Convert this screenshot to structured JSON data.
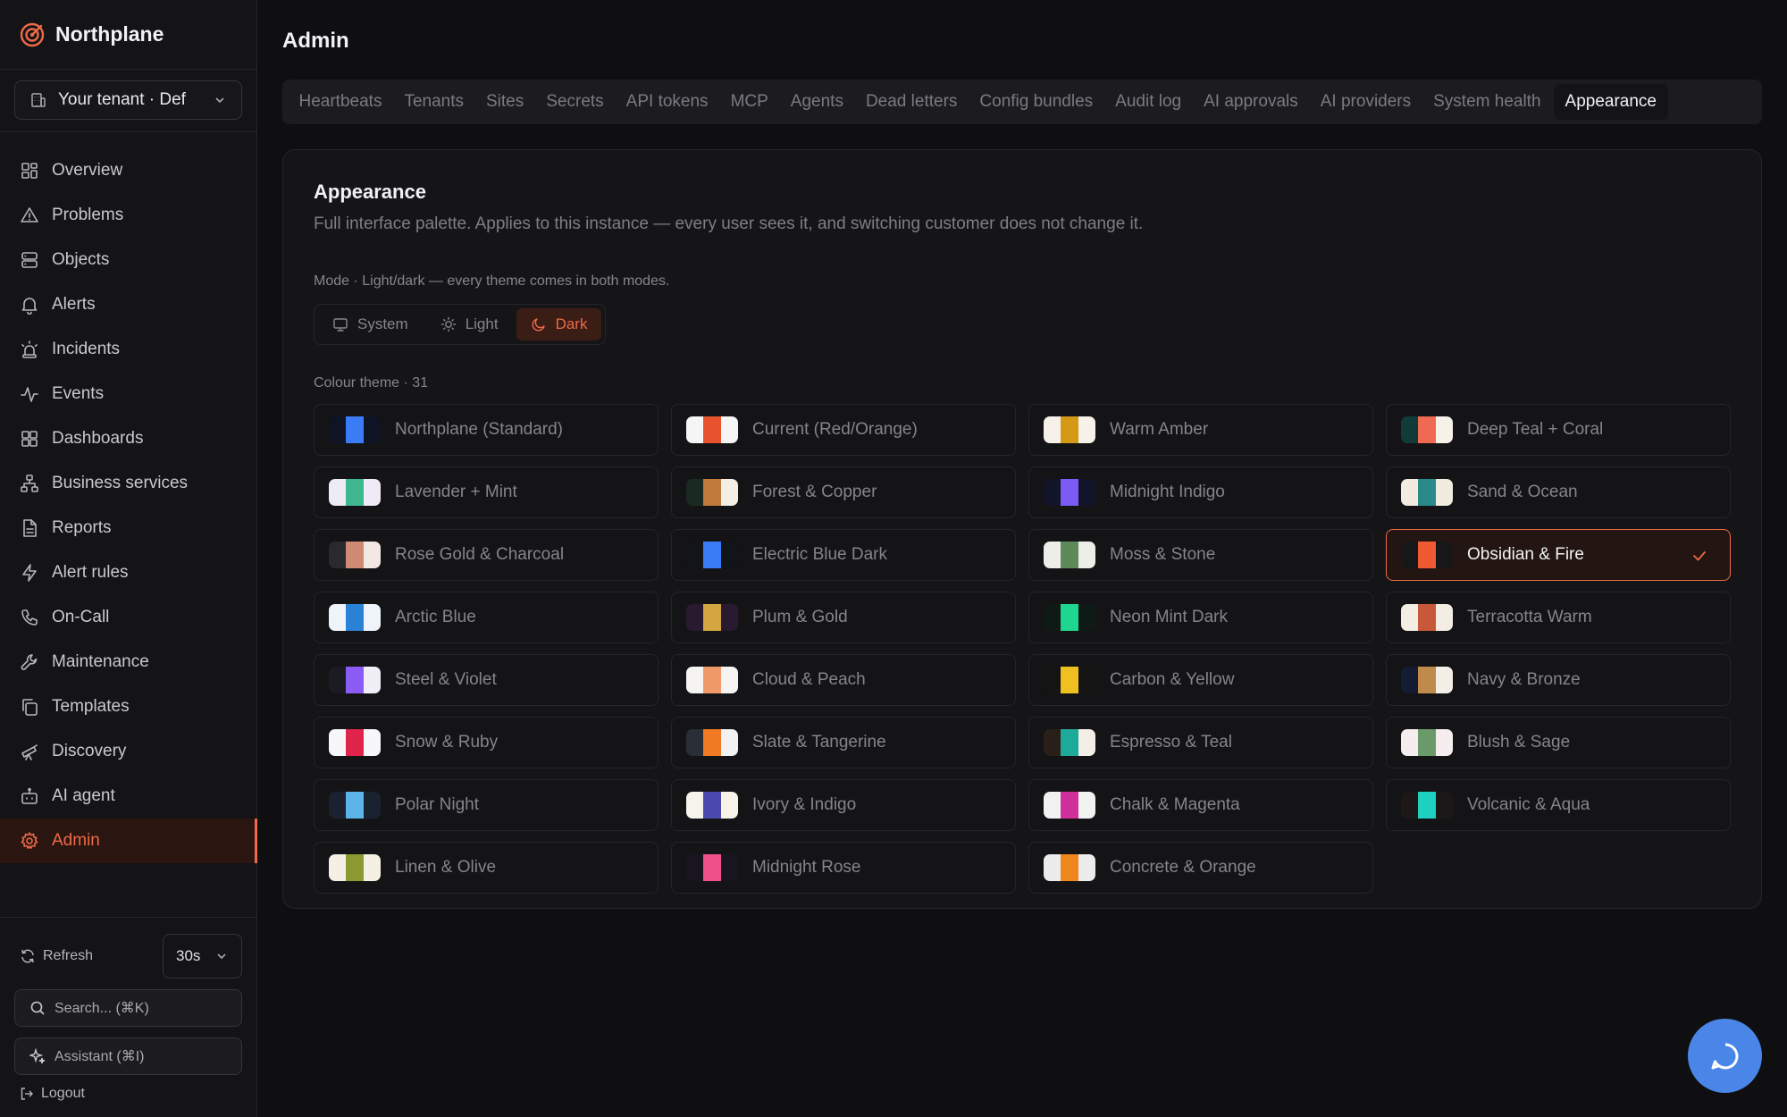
{
  "brand": {
    "name": "Northplane"
  },
  "tenant": {
    "label": "Your tenant · Def"
  },
  "nav": [
    {
      "label": "Overview",
      "icon": "grid-icon"
    },
    {
      "label": "Problems",
      "icon": "warning-icon"
    },
    {
      "label": "Objects",
      "icon": "server-icon"
    },
    {
      "label": "Alerts",
      "icon": "bell-icon"
    },
    {
      "label": "Incidents",
      "icon": "siren-icon"
    },
    {
      "label": "Events",
      "icon": "activity-icon"
    },
    {
      "label": "Dashboards",
      "icon": "dashboard-icon"
    },
    {
      "label": "Business services",
      "icon": "network-icon"
    },
    {
      "label": "Reports",
      "icon": "report-icon"
    },
    {
      "label": "Alert rules",
      "icon": "bolt-icon"
    },
    {
      "label": "On-Call",
      "icon": "phone-icon"
    },
    {
      "label": "Maintenance",
      "icon": "wrench-icon"
    },
    {
      "label": "Templates",
      "icon": "copy-icon"
    },
    {
      "label": "Discovery",
      "icon": "telescope-icon"
    },
    {
      "label": "AI agent",
      "icon": "bot-icon"
    },
    {
      "label": "Admin",
      "icon": "gear-icon",
      "active": true
    }
  ],
  "sidebar_bottom": {
    "refresh_label": "Refresh",
    "interval": "30s",
    "search_label": "Search... (⌘K)",
    "assistant_label": "Assistant (⌘I)",
    "logout_label": "Logout"
  },
  "page": {
    "title": "Admin"
  },
  "tabs": [
    "Heartbeats",
    "Tenants",
    "Sites",
    "Secrets",
    "API tokens",
    "MCP",
    "Agents",
    "Dead letters",
    "Config bundles",
    "Audit log",
    "AI approvals",
    "AI providers",
    "System health",
    "Appearance"
  ],
  "active_tab": "Appearance",
  "appearance": {
    "title": "Appearance",
    "description": "Full interface palette. Applies to this instance — every user sees it, and switching customer does not change it.",
    "mode_label": "Mode · Light/dark — every theme comes in both modes.",
    "modes": [
      {
        "label": "System",
        "icon": "monitor-icon"
      },
      {
        "label": "Light",
        "icon": "sun-icon"
      },
      {
        "label": "Dark",
        "icon": "moon-icon",
        "active": true
      }
    ],
    "theme_label": "Colour theme · 31",
    "accent_color": "#ee6a48"
  },
  "themes": [
    {
      "name": "Northplane (Standard)",
      "colors": [
        "#0e1424",
        "#3b7bf5",
        "#0e1424"
      ]
    },
    {
      "name": "Current (Red/Orange)",
      "colors": [
        "#f5f5f5",
        "#e8532e",
        "#f5f5f5"
      ]
    },
    {
      "name": "Warm Amber",
      "colors": [
        "#f6f2ea",
        "#d49a16",
        "#f6f2ea"
      ]
    },
    {
      "name": "Deep Teal + Coral",
      "colors": [
        "#123a38",
        "#f06a52",
        "#f6f2ea"
      ]
    },
    {
      "name": "Lavender + Mint",
      "colors": [
        "#eeeaf6",
        "#3fb890",
        "#eeeaf6"
      ]
    },
    {
      "name": "Forest & Copper",
      "colors": [
        "#1a2a20",
        "#c27a3c",
        "#f3efe6"
      ]
    },
    {
      "name": "Midnight Indigo",
      "colors": [
        "#12142a",
        "#7a5cf5",
        "#12142a"
      ]
    },
    {
      "name": "Sand & Ocean",
      "colors": [
        "#f2ece0",
        "#2a8a8a",
        "#f2ece0"
      ]
    },
    {
      "name": "Rose Gold & Charcoal",
      "colors": [
        "#2a2a2e",
        "#d08a74",
        "#f3e8e4"
      ]
    },
    {
      "name": "Electric Blue Dark",
      "colors": [
        "#111418",
        "#3a7cf5",
        "#111418"
      ]
    },
    {
      "name": "Moss & Stone",
      "colors": [
        "#eeeee8",
        "#5e8a5a",
        "#eeeee8"
      ]
    },
    {
      "name": "Obsidian & Fire",
      "colors": [
        "#17171a",
        "#f05a32",
        "#17171a"
      ],
      "selected": true
    },
    {
      "name": "Arctic Blue",
      "colors": [
        "#eef4fa",
        "#2a82d6",
        "#eef4fa"
      ]
    },
    {
      "name": "Plum & Gold",
      "colors": [
        "#2a1a30",
        "#d4a640",
        "#2a1a30"
      ]
    },
    {
      "name": "Neon Mint Dark",
      "colors": [
        "#0f1a16",
        "#1ed690",
        "#0f1a16"
      ]
    },
    {
      "name": "Terracotta Warm",
      "colors": [
        "#f4ede4",
        "#c8583a",
        "#f4ede4"
      ]
    },
    {
      "name": "Steel & Violet",
      "colors": [
        "#1a1c22",
        "#8a5cf5",
        "#f0eef6"
      ]
    },
    {
      "name": "Cloud & Peach",
      "colors": [
        "#f6f4f2",
        "#f09a6a",
        "#f6f4f2"
      ]
    },
    {
      "name": "Carbon & Yellow",
      "colors": [
        "#141414",
        "#f0c020",
        "#141414"
      ]
    },
    {
      "name": "Navy & Bronze",
      "colors": [
        "#141c34",
        "#c08a4a",
        "#f3efe6"
      ]
    },
    {
      "name": "Snow & Ruby",
      "colors": [
        "#f7f7f9",
        "#e0244c",
        "#f7f7f9"
      ]
    },
    {
      "name": "Slate & Tangerine",
      "colors": [
        "#2a2e36",
        "#f07a24",
        "#f2f2f2"
      ]
    },
    {
      "name": "Espresso & Teal",
      "colors": [
        "#2a1e18",
        "#1eaa9a",
        "#f3efe6"
      ]
    },
    {
      "name": "Blush & Sage",
      "colors": [
        "#f6eeee",
        "#6a9a6a",
        "#f6eeee"
      ]
    },
    {
      "name": "Polar Night",
      "colors": [
        "#1a2230",
        "#5ab4e8",
        "#1a2230"
      ]
    },
    {
      "name": "Ivory & Indigo",
      "colors": [
        "#f6f3ea",
        "#4a4ab0",
        "#f6f3ea"
      ]
    },
    {
      "name": "Chalk & Magenta",
      "colors": [
        "#f2f2f2",
        "#d0309a",
        "#f2f2f2"
      ]
    },
    {
      "name": "Volcanic & Aqua",
      "colors": [
        "#1c1818",
        "#1ed0c0",
        "#1c1818"
      ]
    },
    {
      "name": "Linen & Olive",
      "colors": [
        "#f4f0e4",
        "#8a9a30",
        "#f4f0e4"
      ]
    },
    {
      "name": "Midnight Rose",
      "colors": [
        "#181420",
        "#f0508a",
        "#181420"
      ]
    },
    {
      "name": "Concrete & Orange",
      "colors": [
        "#ececec",
        "#f0861e",
        "#ececec"
      ]
    }
  ]
}
